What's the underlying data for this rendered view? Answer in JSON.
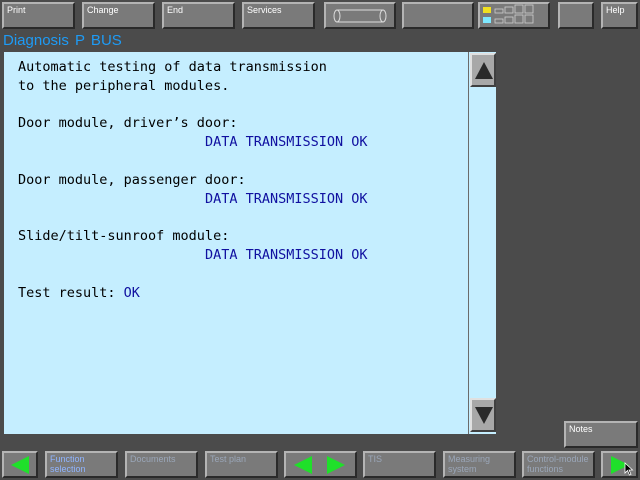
{
  "toolbar": {
    "print": "Print",
    "change": "Change",
    "end": "End",
    "services": "Services",
    "help": "Help"
  },
  "title": "Diagnosis  P BUS",
  "content": {
    "intro_line1": "Automatic testing of data transmission",
    "intro_line2": "to the peripheral modules.",
    "modules": [
      {
        "name": "Door module, driver’s door:",
        "status": "DATA TRANSMISSION OK"
      },
      {
        "name": "Door module, passenger door:",
        "status": "DATA TRANSMISSION OK"
      },
      {
        "name": "Slide/tilt-sunroof module:",
        "status": "DATA TRANSMISSION OK"
      }
    ],
    "result_label": "Test result: ",
    "result_value": "OK"
  },
  "side": {
    "notes": "Notes"
  },
  "bottombar": {
    "function_selection": "Function selection",
    "documents": "Documents",
    "test_plan": "Test plan",
    "tis": "TIS",
    "measuring_system": "Measuring system",
    "control_module_functions": "Control-module functions"
  },
  "colors": {
    "background": "#4b4b4b",
    "content_bg": "#c5eeff",
    "title": "#1e9bf5",
    "ok_text": "#1010a0",
    "arrow": "#1fe02a"
  }
}
